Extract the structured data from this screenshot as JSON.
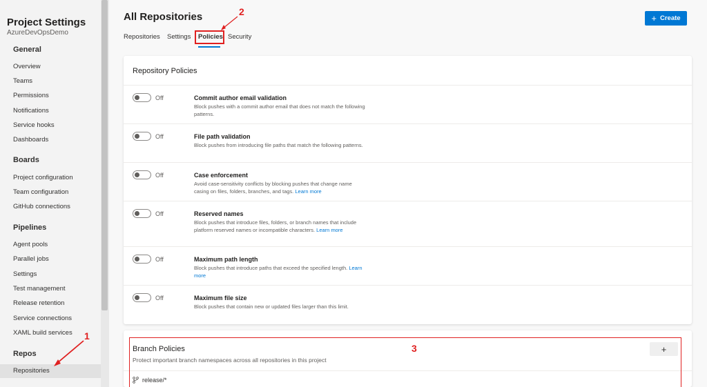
{
  "sidebar": {
    "project_title": "Project Settings",
    "project_name": "AzureDevOpsDemo",
    "sections": {
      "general": "General",
      "boards": "Boards",
      "pipelines": "Pipelines",
      "repos": "Repos"
    },
    "general_items": [
      "Overview",
      "Teams",
      "Permissions",
      "Notifications",
      "Service hooks",
      "Dashboards"
    ],
    "boards_items": [
      "Project configuration",
      "Team configuration",
      "GitHub connections"
    ],
    "pipelines_items": [
      "Agent pools",
      "Parallel jobs",
      "Settings",
      "Test management",
      "Release retention",
      "Service connections",
      "XAML build services"
    ],
    "repos_items": [
      "Repositories"
    ]
  },
  "header": {
    "title": "All Repositories",
    "create_label": "Create"
  },
  "tabs": [
    "Repositories",
    "Settings",
    "Policies",
    "Security"
  ],
  "repo_policies": {
    "title": "Repository Policies",
    "toggle_off_label": "Off",
    "items": [
      {
        "name": "Commit author email validation",
        "desc": "Block pushes with a commit author email that does not match the following patterns.",
        "link": ""
      },
      {
        "name": "File path validation",
        "desc": "Block pushes from introducing file paths that match the following patterns.",
        "link": ""
      },
      {
        "name": "Case enforcement",
        "desc": "Avoid case-sensitivity conflicts by blocking pushes that change name casing on files, folders, branches, and tags.",
        "link": "Learn more"
      },
      {
        "name": "Reserved names",
        "desc": "Block pushes that introduce files, folders, or branch names that include platform reserved names or incompatible characters.",
        "link": "Learn more"
      },
      {
        "name": "Maximum path length",
        "desc": "Block pushes that introduce paths that exceed the specified length.",
        "link": "Learn more"
      },
      {
        "name": "Maximum file size",
        "desc": "Block pushes that contain new or updated files larger than this limit.",
        "link": ""
      }
    ]
  },
  "branch_policies": {
    "title": "Branch Policies",
    "subtitle": "Protect important branch namespaces across all repositories in this project",
    "add_label": "+",
    "branch": "release/*"
  },
  "annotations": [
    "1",
    "2",
    "3"
  ]
}
